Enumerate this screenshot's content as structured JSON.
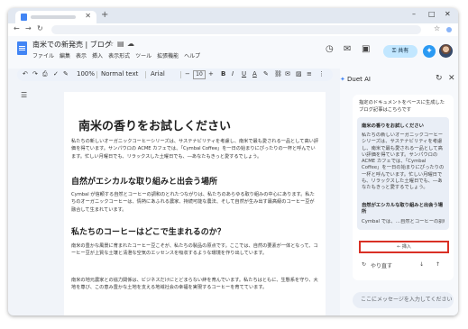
{
  "browser": {
    "window_controls": [
      "–",
      "□",
      "✕"
    ],
    "new_tab": "+",
    "tab_close": "✕",
    "nav": [
      "←",
      "→",
      "↻"
    ],
    "star": "☆"
  },
  "docs": {
    "title": "南米での新発売 | ブログ",
    "menu": [
      "ファイル",
      "編集",
      "表示",
      "挿入",
      "表示形式",
      "ツール",
      "拡張機能",
      "ヘルプ"
    ],
    "share_label": "共有"
  },
  "toolbar": {
    "zoom": "100%",
    "style": "Normal text",
    "font": "Arial",
    "font_size": "10",
    "bold": "B",
    "italic": "I",
    "underline": "U",
    "text_color": "A"
  },
  "document": {
    "title": "南米の香りをお試しください",
    "p1": "私たちの新しいオーガニックコーヒーシリーズは、サステナビリティを考慮し、南米で最も愛される一品として高い評価を得ています。サンパウロの ACME カフェでは、「Cymbal Coffee」を一日の始まりにぴったりの一杯と呼んでいます。忙しい月曜日でも、リラックスした土曜日でも、―あなたもきっと愛するでしょう。",
    "h2a": "自然がエシカルな取り組みと出会う場所",
    "p2": "Cymbal が信頼する自然とコーヒーの調和のとれたつながりは、私たちのあらゆる取り組みの中心にあります。私たちのオーガニックコーヒーは、情熱にあふれる農家、持続可能な農法、そして自然が生み出す最高級のコーヒー豆が融合して生まれています。",
    "h2b": "私たちのコーヒーはどこで生まれるのか？",
    "p3": "南米の豊かな風景に育まれたコーヒー豆こそが、私たちの製品の原点です。ここでは、自然の要素が一体となって、コーヒー豆が上質な土壌と清澄な空気のエッセンスを吸収するような環境を作り出しています。",
    "p4": "南米の地元農家との協力関係は、ビジネスだけにとどまらない絆を育んでいます。私たちはともに、生態系を守り、大地を尊び、この恵み豊かな土地を支える地域社会の幸福を実現するコーヒーを育てています。"
  },
  "duet": {
    "title": "Duet AI",
    "intro": "指定のドキュメントをベースに生成したブログ記事はこちらです",
    "card_heading": "南米の香りをお試しください",
    "card_body": "私たちの新しいオーガニックコーヒーシリーズは、サステナビリティを考慮し、南米で最も愛される一品として高い評価を得ています。サンパウロの ACME カフェでは、「Cymbal Coffee」を一日の始まりにぴったりの一杯と呼んでいます。忙しい月曜日でも、リラックスした土曜日でも、―あなたもきっと愛するでしょう。",
    "card_heading2": "自然がエシカルな取り組みと出会う場所",
    "card_tail": "Cymbal では、…自然とコーヒーの調和のとれたつ",
    "insert_label": "← 挿入",
    "retry_label": "やり直す",
    "input_placeholder": "ここにメッセージを入力してください"
  },
  "icons": {
    "undo": "↶",
    "redo": "↷",
    "print": "⎙",
    "spell": "✓",
    "paint": "✎",
    "history": "◷",
    "comment": "✉",
    "video": "▣",
    "lock": "⚿",
    "spark": "✦",
    "refresh": "↻",
    "close": "✕",
    "thumbs_down": "↓",
    "thumbs_up": "↑",
    "outline": "☰",
    "star": "☆",
    "folder": "▤",
    "cloud": "☁"
  },
  "colors": {
    "accent": "#4285f4",
    "share_bg": "#c2e7ff",
    "highlight": "#d93025"
  }
}
